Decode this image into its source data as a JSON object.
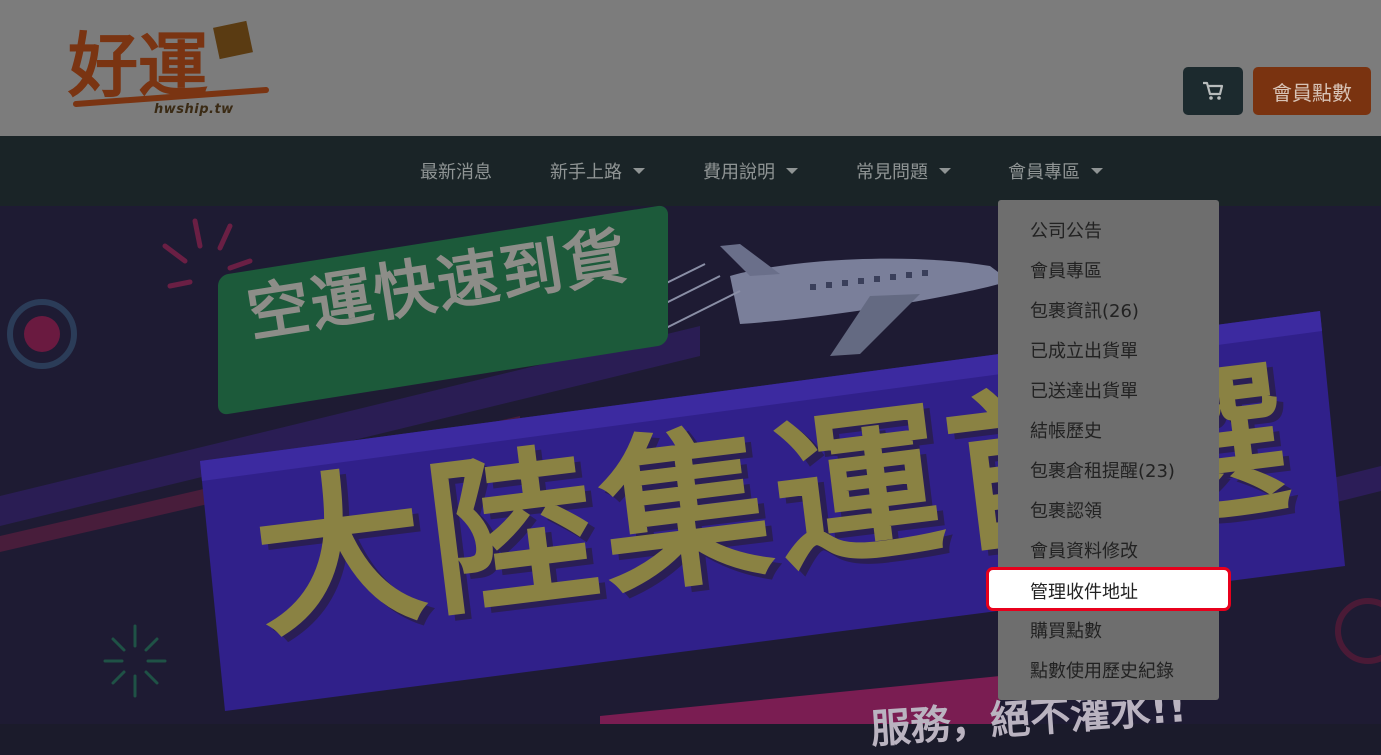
{
  "header": {
    "logo_text": "好運",
    "logo_subtext": "hwship.tw",
    "cart_icon": "cart-icon",
    "points_button_label": "會員點數"
  },
  "nav": {
    "items": [
      {
        "label": "最新消息",
        "has_dropdown": false
      },
      {
        "label": "新手上路",
        "has_dropdown": true
      },
      {
        "label": "費用說明",
        "has_dropdown": true
      },
      {
        "label": "常見問題",
        "has_dropdown": true
      },
      {
        "label": "會員專區",
        "has_dropdown": true
      }
    ]
  },
  "dropdown": {
    "items": [
      "公司公告",
      "會員專區",
      "包裹資訊(26)",
      "已成立出貨單",
      "已送達出貨單",
      "結帳歷史",
      "包裹倉租提醒(23)",
      "包裹認領",
      "會員資料修改",
      "管理收件地址",
      "購買點數",
      "點數使用歷史紀錄"
    ],
    "highlighted": "管理收件地址"
  },
  "banner": {
    "tag_text": "空運快速到貨",
    "headline": "大陸集運首選",
    "subline": "服務，絕不灌水!!"
  },
  "colors": {
    "overlay_dim": "#7c7c7c",
    "navbar": "#1a2427",
    "points_button": "#7a3310",
    "highlight_border": "#e8001c"
  }
}
